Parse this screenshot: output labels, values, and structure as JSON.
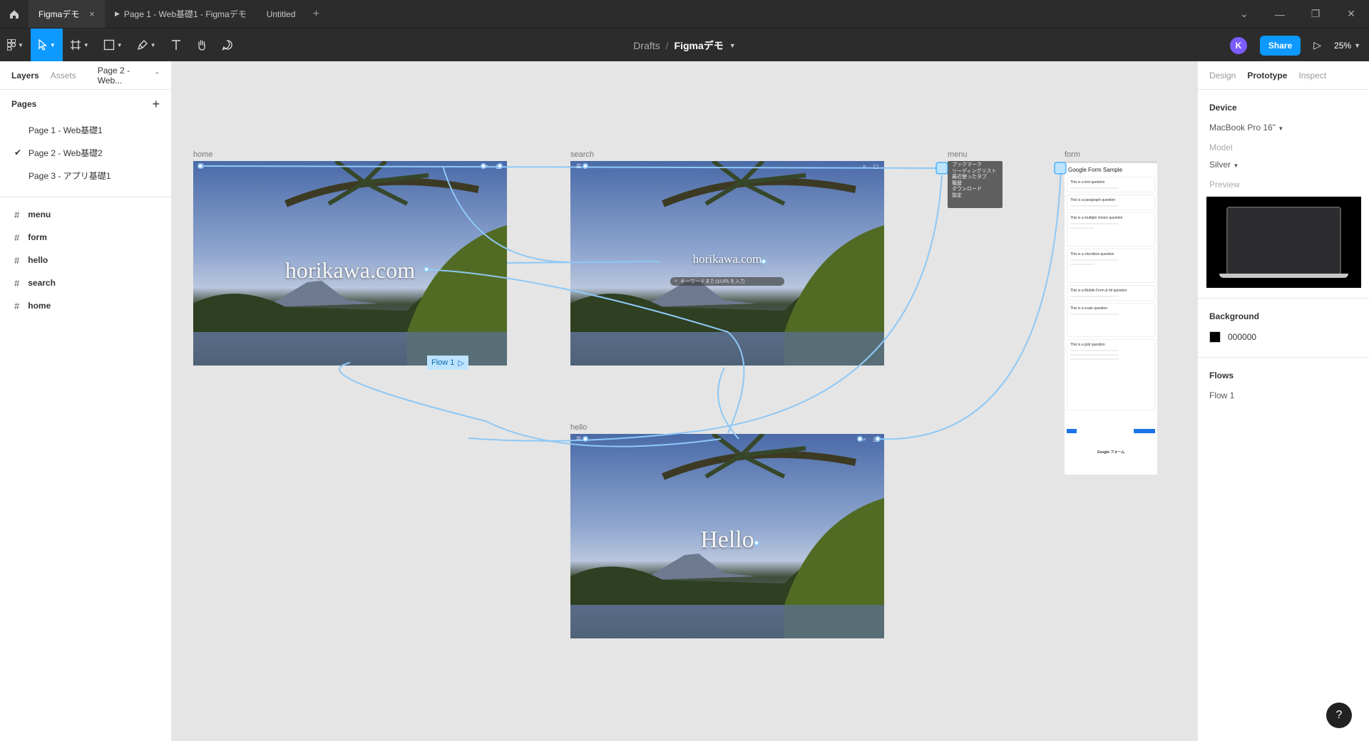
{
  "tabs": [
    {
      "label": "Figmaデモ",
      "active": true,
      "has_close": true
    },
    {
      "label": "Page 1 - Web基礎1 - Figmaデモ",
      "active": false,
      "has_play": true
    },
    {
      "label": "Untitled",
      "active": false
    }
  ],
  "toolbar": {
    "breadcrumb_root": "Drafts",
    "breadcrumb_sep": "/",
    "file_name": "Figmaデモ",
    "avatar_initial": "K",
    "share_label": "Share",
    "zoom": "25%"
  },
  "left_panel": {
    "tabs": [
      "Layers",
      "Assets"
    ],
    "current_page": "Page 2 - Web...",
    "pages_title": "Pages",
    "pages": [
      {
        "label": "Page 1 - Web基礎1",
        "checked": false
      },
      {
        "label": "Page 2 - Web基礎2",
        "checked": true
      },
      {
        "label": "Page 3 - アプリ基礎1",
        "checked": false
      }
    ],
    "layers": [
      "menu",
      "form",
      "hello",
      "search",
      "home"
    ]
  },
  "canvas": {
    "frames": {
      "home": {
        "label": "home",
        "text": "horikawa.com"
      },
      "search": {
        "label": "search",
        "text": "horikawa.com",
        "search_placeholder": "キーワードまたはURLを入力"
      },
      "menu": {
        "label": "menu",
        "items": [
          "ブックマーク",
          "リーディングリスト",
          "最近使ったタブ",
          "履歴",
          "ダウンロード",
          "設定"
        ]
      },
      "form": {
        "label": "form",
        "title": "Google Form Sample",
        "questions": [
          "This is a text question",
          "This is a paragraph question",
          "This is a multiple choice question",
          "This is a checkbox question",
          "This is a Mobile Form & hit question",
          "This is a scale question",
          "This is a grid question"
        ],
        "footer": "Google フォーム"
      },
      "hello": {
        "label": "hello",
        "text": "Hello"
      }
    },
    "flow_tag": "Flow 1"
  },
  "right_panel": {
    "tabs": [
      "Design",
      "Prototype",
      "Inspect"
    ],
    "active_tab": "Prototype",
    "device_title": "Device",
    "device_value": "MacBook Pro 16\"",
    "model_label": "Model",
    "model_value": "Silver",
    "preview_label": "Preview",
    "background_title": "Background",
    "background_value": "000000",
    "flows_title": "Flows",
    "flows": [
      "Flow 1"
    ]
  },
  "help_label": "?",
  "colors": {
    "accent": "#0d99ff",
    "flow_line": "#8ec8f5",
    "chrome": "#2c2c2c",
    "canvas": "#e5e5e5"
  }
}
